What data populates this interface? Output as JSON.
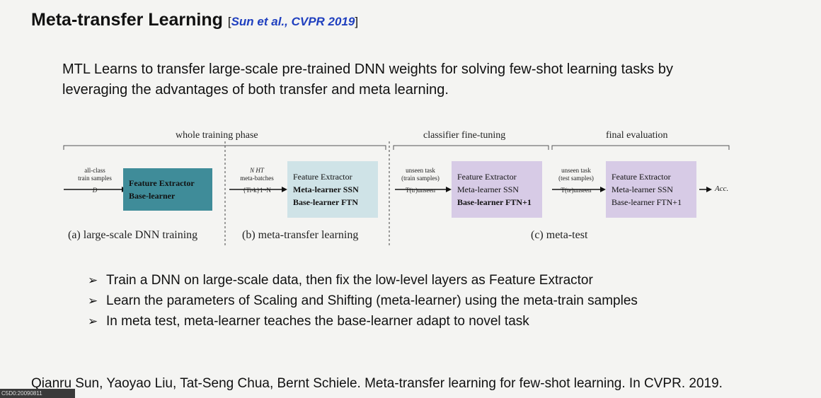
{
  "slide": {
    "title": "Meta-transfer Learning",
    "cite_open": "[",
    "cite_text": "Sun et al., CVPR 2019",
    "cite_close": "]",
    "intro": "MTL Learns to transfer large-scale pre-trained DNN weights for solving few-shot learning tasks by leveraging the advantages of both transfer and meta learning.",
    "figure": {
      "phases": [
        "whole training phase",
        "classifier fine-tuning",
        "final evaluation"
      ],
      "input": {
        "top": "all-class",
        "mid": "train samples",
        "bottom": "D"
      },
      "box1": {
        "line1": "Feature Extractor",
        "line2": "Base-learner"
      },
      "batch": {
        "top": "N HT",
        "mid": "meta-batches",
        "bottom": "{Ti-k}1~N"
      },
      "box2": {
        "line1": "Feature Extractor",
        "line2": "Meta-learner SSN",
        "line3": "Base-learner FTN"
      },
      "unseen_train": {
        "top": "unseen task",
        "mid": "(train samples)",
        "bottom": "T(tr)unseen"
      },
      "box3": {
        "line1": "Feature Extractor",
        "line2": "Meta-learner SSN",
        "line3": "Base-learner FTN+1"
      },
      "unseen_test": {
        "top": "unseen task",
        "mid": "(test samples)",
        "bottom": "T(te)unseen"
      },
      "box4": {
        "line1": "Feature Extractor",
        "line2": "Meta-learner SSN",
        "line3": "Base-learner FTN+1"
      },
      "output": "Acc.",
      "captions": [
        "(a) large-scale DNN training",
        "(b) meta-transfer learning",
        "(c) meta-test"
      ]
    },
    "bullet_marker": "➢",
    "bullets": [
      "Train a DNN on large-scale data, then fix the low-level layers as Feature Extractor",
      "Learn the parameters of Scaling and Shifting (meta-learner) using the meta-train samples",
      "In meta test, meta-learner teaches the base-learner adapt to novel task"
    ],
    "reference": "Qianru Sun, Yaoyao Liu, Tat-Seng Chua, Bernt Schiele. Meta-transfer learning for few-shot learning. In CVPR. 2019.",
    "badge": "C5D0:20090811"
  }
}
